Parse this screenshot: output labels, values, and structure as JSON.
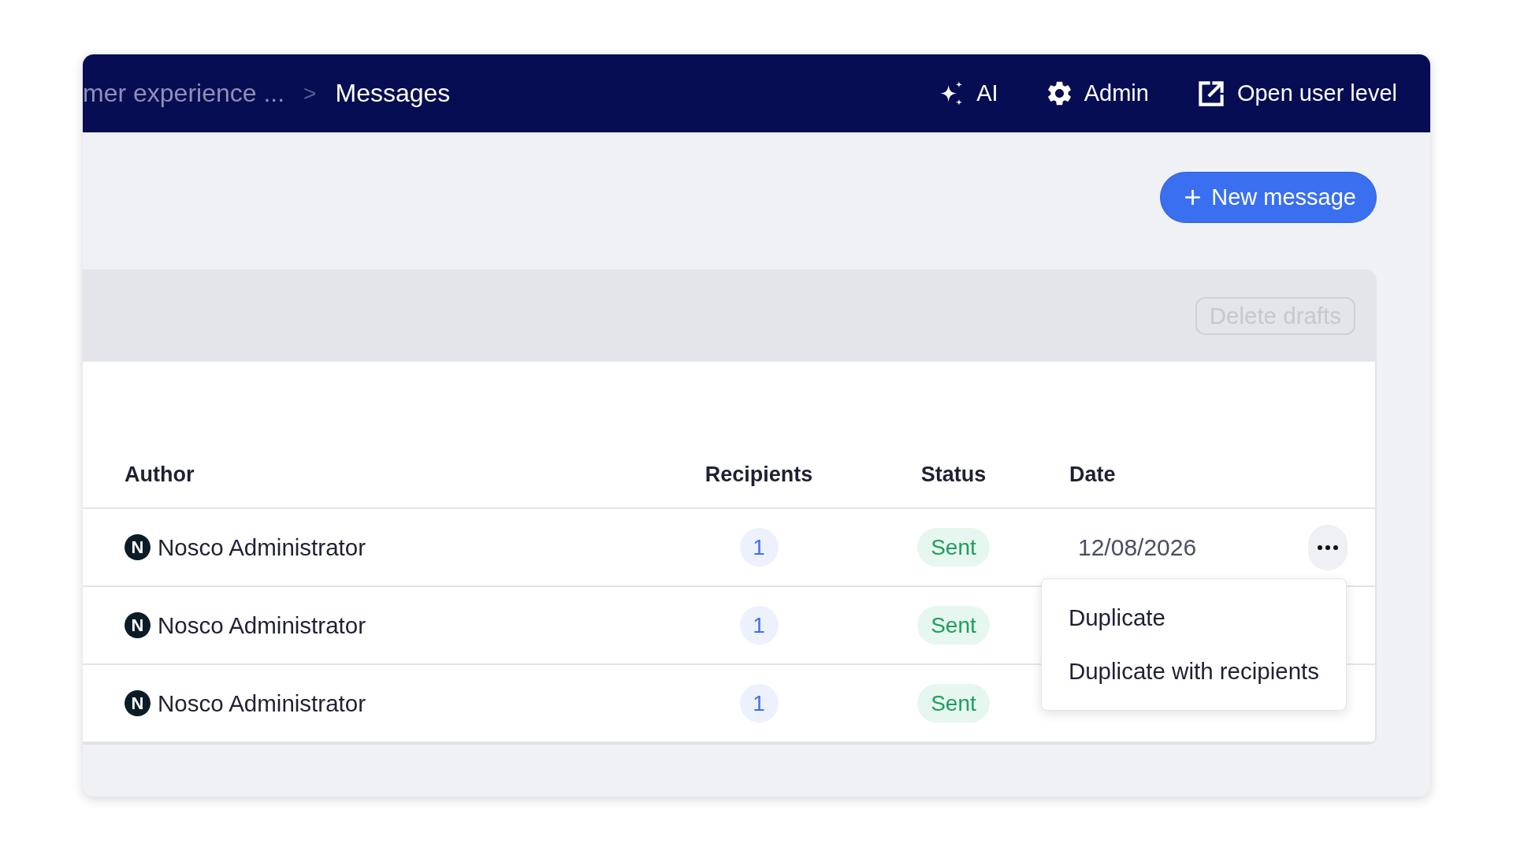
{
  "header": {
    "breadcrumbs": [
      {
        "label": "mer experience ...",
        "current": false
      },
      {
        "label": "Messages",
        "current": true
      }
    ],
    "separator": ">",
    "actions": [
      {
        "kind": "ai",
        "label": "AI"
      },
      {
        "kind": "admin",
        "label": "Admin"
      },
      {
        "kind": "external",
        "label": "Open user level"
      }
    ]
  },
  "toolbar": {
    "new_button": {
      "label": "New message"
    },
    "delete_button": {
      "label": "Delete drafts",
      "disabled": true
    }
  },
  "table": {
    "columns": [
      "Author",
      "Recipients",
      "Status",
      "Date"
    ],
    "rows": [
      {
        "initial": "N",
        "author": "Nosco Administrator",
        "recipients": "1",
        "status": "Sent",
        "date": "12/08/2026",
        "menu_open": true
      },
      {
        "initial": "N",
        "author": "Nosco Administrator",
        "recipients": "1",
        "status": "Sent",
        "menu_open": false
      },
      {
        "initial": "N",
        "author": "Nosco Administrator",
        "recipients": "1",
        "status": "Sent",
        "menu_open": false
      }
    ]
  },
  "row_menu": {
    "items": [
      "Duplicate",
      "Duplicate with recipients"
    ]
  }
}
